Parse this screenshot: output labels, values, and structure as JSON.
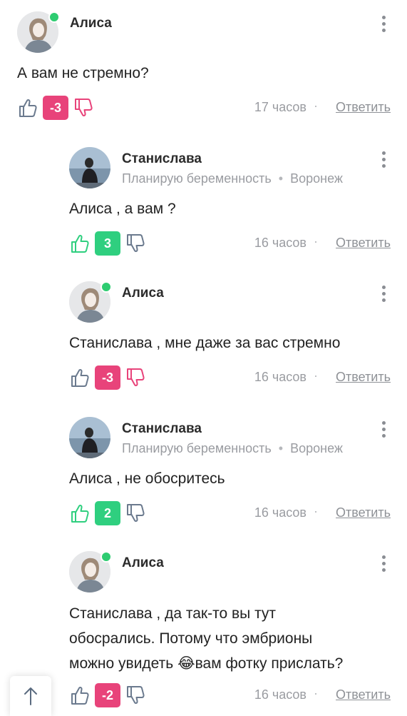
{
  "comments": [
    {
      "author": "Алиса",
      "online": true,
      "meta": null,
      "text": "А вам не стремно?",
      "score": "-3",
      "score_kind": "neg",
      "time": "17 часов",
      "reply_label": "Ответить"
    },
    {
      "author": "Станислава",
      "online": false,
      "meta": {
        "status": "Планирую беременность",
        "city": "Воронеж"
      },
      "text": "Алиса , а вам ?",
      "score": "3",
      "score_kind": "pos",
      "time": "16 часов",
      "reply_label": "Ответить"
    },
    {
      "author": "Алиса",
      "online": true,
      "meta": null,
      "text": "Станислава , мне даже за вас стремно",
      "score": "-3",
      "score_kind": "neg",
      "time": "16 часов",
      "reply_label": "Ответить"
    },
    {
      "author": "Станислава",
      "online": false,
      "meta": {
        "status": "Планирую беременность",
        "city": "Воронеж"
      },
      "text": "Алиса , не обосритесь",
      "score": "2",
      "score_kind": "pos",
      "time": "16 часов",
      "reply_label": "Ответить"
    },
    {
      "author": "Алиса",
      "online": true,
      "meta": null,
      "text_parts": [
        "Станислава , да так-то вы тут",
        "обосрались. Потому что эмбрионы",
        "можно увидеть ",
        "😂",
        "вам фотку прислать?"
      ],
      "score": "-2",
      "score_kind": "neg",
      "time": "16 часов",
      "reply_label": "Ответить"
    }
  ],
  "colors": {
    "online": "#2ecc71",
    "negative": "#e8437a",
    "positive": "#2fcf7f",
    "muted": "#9a9ca1"
  },
  "icons": {
    "thumb_up": "thumb-up-icon",
    "thumb_down": "thumb-down-icon",
    "menu": "kebab-menu-icon",
    "scroll_top": "arrow-up-icon"
  }
}
